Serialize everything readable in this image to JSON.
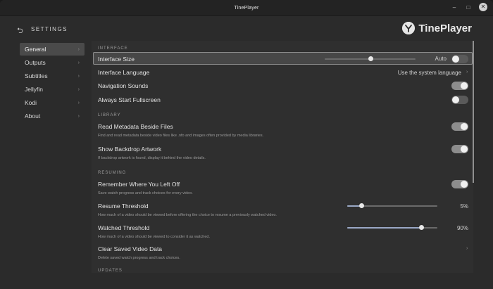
{
  "window": {
    "title": "TinePlayer"
  },
  "header": {
    "back_icon": "back-arrow-icon",
    "title": "SETTINGS",
    "brand": "TinePlayer"
  },
  "sidebar": {
    "items": [
      {
        "label": "General",
        "active": true
      },
      {
        "label": "Outputs"
      },
      {
        "label": "Subtitles"
      },
      {
        "label": "Jellyfin"
      },
      {
        "label": "Kodi"
      },
      {
        "label": "About"
      }
    ]
  },
  "interface": {
    "heading": "INTERFACE",
    "size": {
      "label": "Interface Size",
      "value_label": "Auto",
      "slider_level": 0.5,
      "toggle_on": false
    },
    "language": {
      "label": "Interface Language",
      "value": "Use the system language"
    },
    "nav_sounds": {
      "label": "Navigation Sounds",
      "on": true
    },
    "fullscreen": {
      "label": "Always Start Fullscreen",
      "on": false
    }
  },
  "library": {
    "heading": "LIBRARY",
    "metadata": {
      "label": "Read Metadata Beside Files",
      "desc": "Find and read metadata beside video files like .nfo and images often provided by media libraries.",
      "on": true
    },
    "backdrop": {
      "label": "Show Backdrop Artwork",
      "desc": "If backdrop artwork is found, display it behind the video details.",
      "on": true
    }
  },
  "resuming": {
    "heading": "RESUMING",
    "remember": {
      "label": "Remember Where You Left Off",
      "desc": "Save watch progress and track choices for every video.",
      "on": true
    },
    "resume_threshold": {
      "label": "Resume Threshold",
      "desc": "How much of a video should be viewed before offering the choice to resume a previously watched video.",
      "value": "5%",
      "level": 0.16
    },
    "watched_threshold": {
      "label": "Watched Threshold",
      "desc": "How much of a video should be viewed to consider it as watched.",
      "value": "90%",
      "level": 0.82
    },
    "clear": {
      "label": "Clear Saved Video Data",
      "desc": "Delete saved watch progress and track choices."
    }
  },
  "updates": {
    "heading": "UPDATES"
  },
  "colors": {
    "accent": "#9aa8c6",
    "toggle_on": "#8d8d8d",
    "toggle_off": "#5a5a5a"
  }
}
